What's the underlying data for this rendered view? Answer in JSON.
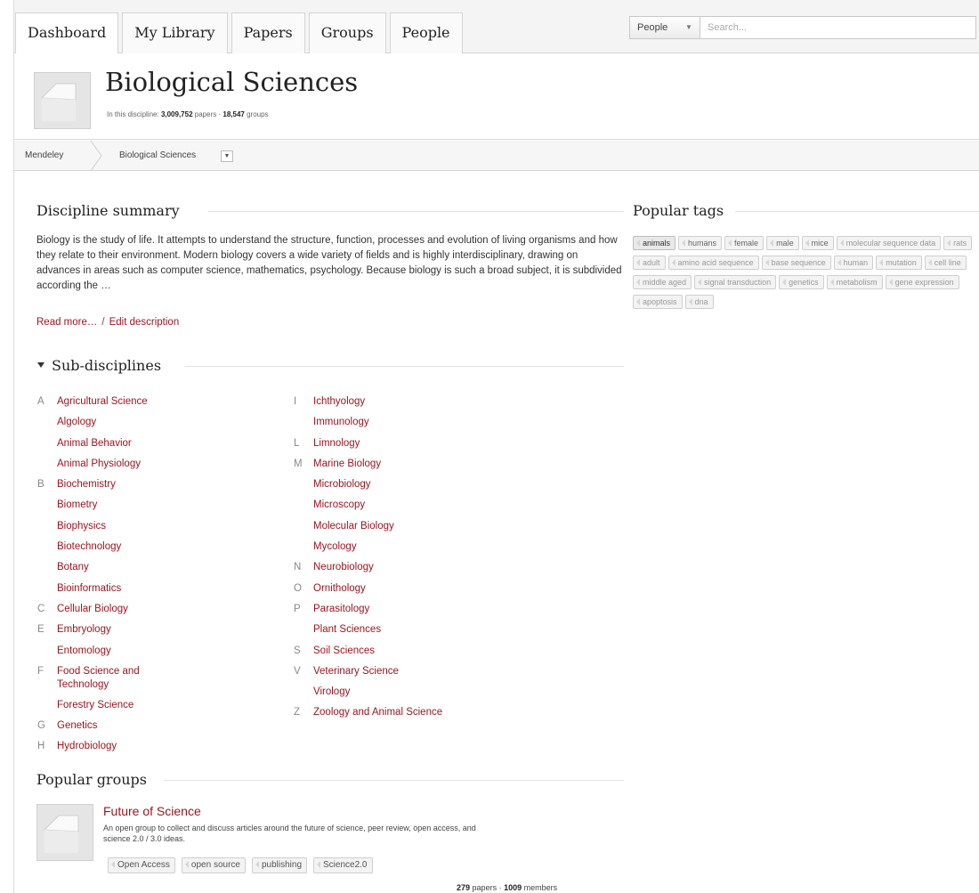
{
  "nav": {
    "tabs": [
      "Dashboard",
      "My Library",
      "Papers",
      "Groups",
      "People"
    ],
    "search_scope": "People",
    "search_placeholder": "Search..."
  },
  "discipline": {
    "title": "Biological Sciences",
    "stats_prefix": "In this discipline:",
    "papers_count": "3,009,752",
    "papers_label": "papers",
    "stats_sep": "·",
    "groups_count": "18,547",
    "groups_label": "groups"
  },
  "breadcrumb": [
    "Mendeley",
    "Biological Sciences"
  ],
  "summary": {
    "heading": "Discipline summary",
    "text": "Biology is the study of life. It attempts to understand the structure, function, processes and evolution of living organisms and how they relate to their environment. Modern biology covers a wide variety of fields and is highly interdisciplinary, drawing on advances in areas such as computer science, mathematics, psychology. Because biology is such a broad subject, it is subdivided according the …",
    "read_more": "Read more…",
    "slash": "/",
    "edit": "Edit description"
  },
  "subdisciplines": {
    "heading": "Sub-disciplines",
    "left": [
      {
        "letter": "A",
        "name": "Agricultural Science"
      },
      {
        "letter": "",
        "name": "Algology"
      },
      {
        "letter": "",
        "name": "Animal Behavior"
      },
      {
        "letter": "",
        "name": "Animal Physiology"
      },
      {
        "letter": "B",
        "name": "Biochemistry"
      },
      {
        "letter": "",
        "name": "Biometry"
      },
      {
        "letter": "",
        "name": "Biophysics"
      },
      {
        "letter": "",
        "name": "Biotechnology"
      },
      {
        "letter": "",
        "name": "Botany"
      },
      {
        "letter": "",
        "name": "Bioinformatics"
      },
      {
        "letter": "C",
        "name": "Cellular Biology"
      },
      {
        "letter": "E",
        "name": "Embryology"
      },
      {
        "letter": "",
        "name": "Entomology"
      },
      {
        "letter": "F",
        "name": "Food Science and Technology"
      },
      {
        "letter": "",
        "name": "Forestry Science"
      },
      {
        "letter": "G",
        "name": "Genetics"
      },
      {
        "letter": "H",
        "name": "Hydrobiology"
      }
    ],
    "right": [
      {
        "letter": "I",
        "name": "Ichthyology"
      },
      {
        "letter": "",
        "name": "Immunology"
      },
      {
        "letter": "L",
        "name": "Limnology"
      },
      {
        "letter": "M",
        "name": "Marine Biology"
      },
      {
        "letter": "",
        "name": "Microbiology"
      },
      {
        "letter": "",
        "name": "Microscopy"
      },
      {
        "letter": "",
        "name": "Molecular Biology"
      },
      {
        "letter": "",
        "name": "Mycology"
      },
      {
        "letter": "N",
        "name": "Neurobiology"
      },
      {
        "letter": "O",
        "name": "Ornithology"
      },
      {
        "letter": "P",
        "name": "Parasitology"
      },
      {
        "letter": "",
        "name": "Plant Sciences"
      },
      {
        "letter": "S",
        "name": "Soil Sciences"
      },
      {
        "letter": "V",
        "name": "Veterinary Science"
      },
      {
        "letter": "",
        "name": "Virology"
      },
      {
        "letter": "Z",
        "name": "Zoology and Animal Science"
      }
    ]
  },
  "groups": {
    "heading": "Popular groups",
    "items": [
      {
        "name": "Future of Science",
        "description": "An open group to collect and discuss articles around the future of science, peer review, open access, and science 2.0 / 3.0 ideas.",
        "tags": [
          "Open Access",
          "open source",
          "publishing",
          "Science2.0"
        ],
        "papers_count": "279",
        "papers_label": "papers",
        "sep": "·",
        "members_count": "1009",
        "members_label": "members"
      }
    ]
  },
  "popular_tags": {
    "heading": "Popular tags",
    "tags": [
      {
        "label": "animals",
        "weight": "strong"
      },
      {
        "label": "humans",
        "weight": "mid"
      },
      {
        "label": "female",
        "weight": "mid"
      },
      {
        "label": "male",
        "weight": "mid"
      },
      {
        "label": "mice",
        "weight": "mid"
      },
      {
        "label": "molecular sequence data",
        "weight": "light"
      },
      {
        "label": "rats",
        "weight": "light"
      },
      {
        "label": "adult",
        "weight": "light"
      },
      {
        "label": "amino acid sequence",
        "weight": "light"
      },
      {
        "label": "base sequence",
        "weight": "light"
      },
      {
        "label": "human",
        "weight": "light"
      },
      {
        "label": "mutation",
        "weight": "light"
      },
      {
        "label": "cell line",
        "weight": "light"
      },
      {
        "label": "middle aged",
        "weight": "light"
      },
      {
        "label": "signal transduction",
        "weight": "light"
      },
      {
        "label": "genetics",
        "weight": "light"
      },
      {
        "label": "metabolism",
        "weight": "light"
      },
      {
        "label": "gene expression",
        "weight": "light"
      },
      {
        "label": "apoptosis",
        "weight": "light"
      },
      {
        "label": "dna",
        "weight": "light"
      }
    ]
  },
  "colors": {
    "link": "#a0141f"
  }
}
